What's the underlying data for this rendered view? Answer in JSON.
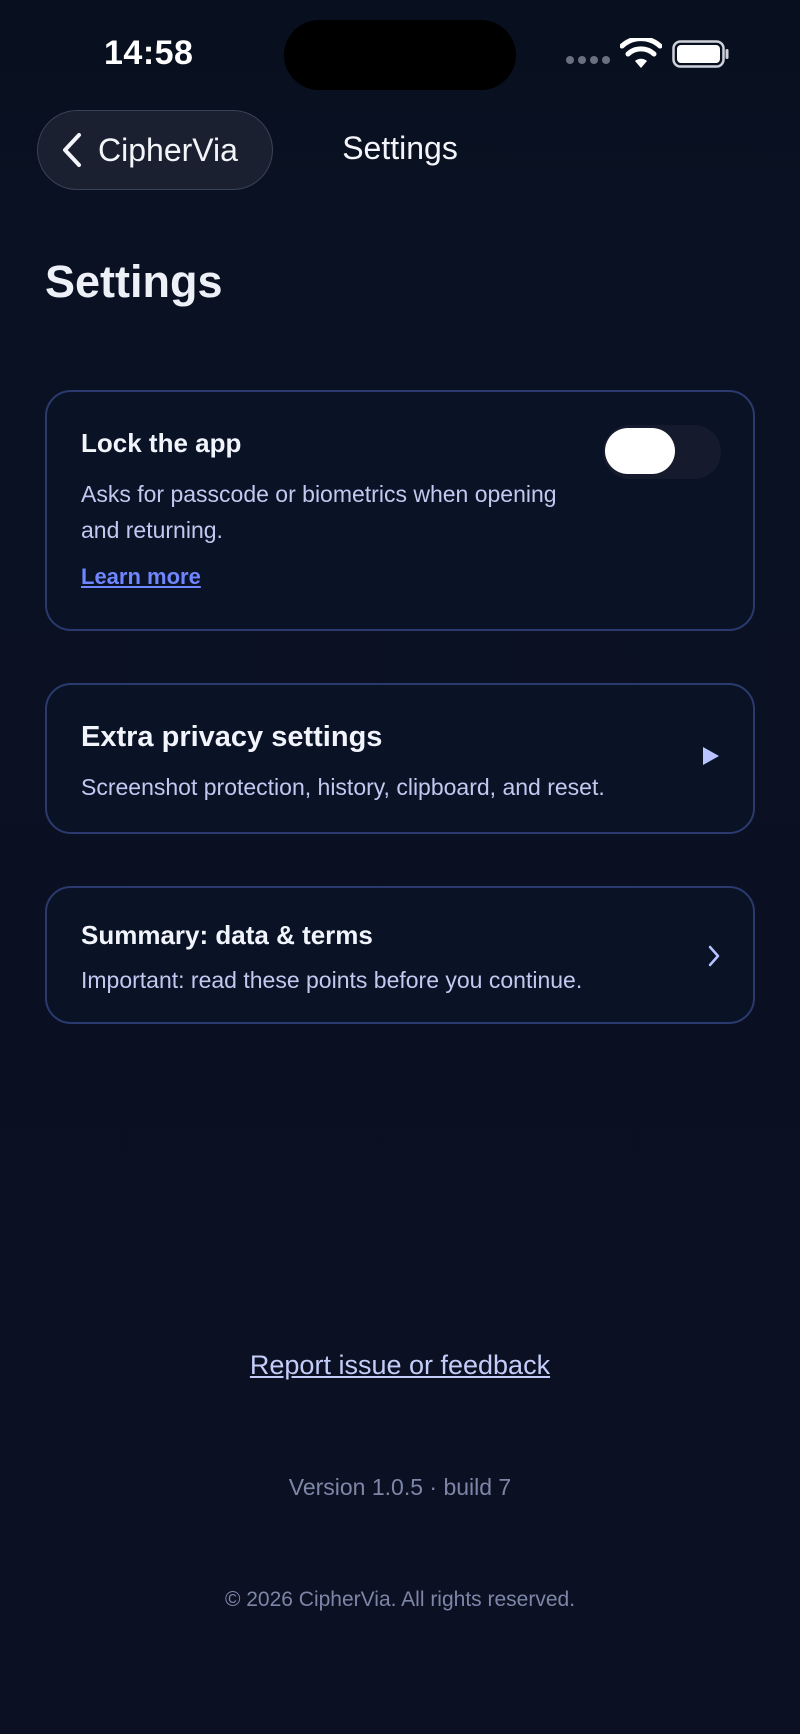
{
  "status_bar": {
    "time": "14:58"
  },
  "nav": {
    "back_label": "CipherVia",
    "title": "Settings"
  },
  "page": {
    "title": "Settings"
  },
  "lock_card": {
    "title": "Lock the app",
    "description": "Asks for passcode or biometrics when opening and returning.",
    "learn_more": "Learn more",
    "toggle_on": false
  },
  "privacy_card": {
    "title": "Extra privacy settings",
    "description": "Screenshot protection, history, clipboard, and reset.",
    "icon": "play-icon"
  },
  "summary_card": {
    "title": "Summary: data & terms",
    "description": "Important: read these points before you continue.",
    "icon": "chevron-right-icon"
  },
  "footer": {
    "report_link": "Report issue or feedback",
    "version": "Version 1.0.5 · build 7",
    "copyright": "© 2026 CipherVia. All rights reserved."
  },
  "colors": {
    "background": "#0b1020",
    "card_border": "#2b3a6e",
    "accent_link": "#6f86ff",
    "muted_text": "#7e86a8"
  }
}
